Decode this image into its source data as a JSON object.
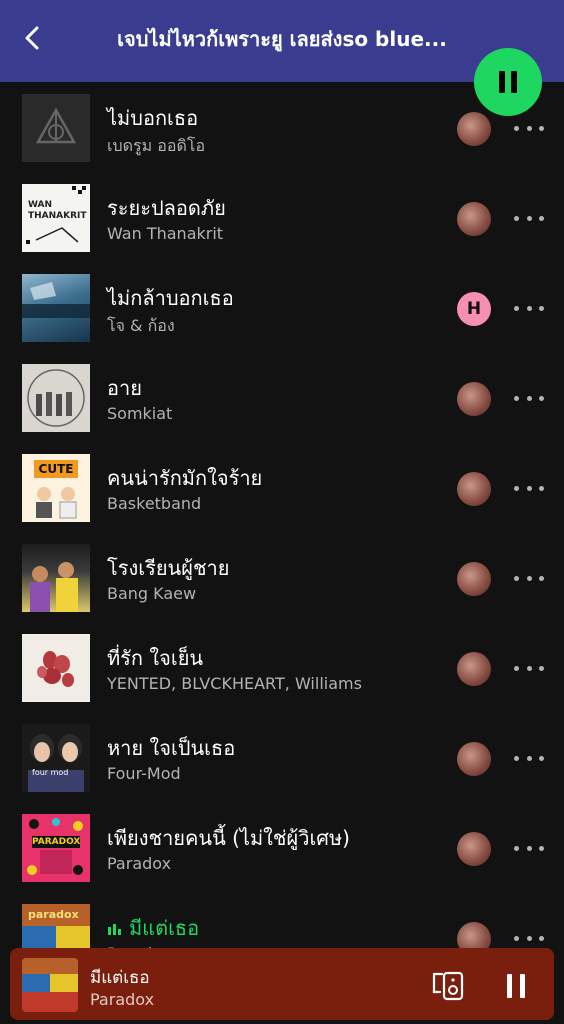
{
  "header": {
    "title": "เจบไม่ไหวก้เพราะยู เลยส่งso blue..."
  },
  "colors": {
    "header_bg": "#3a3d8f",
    "accent": "#1ed760",
    "mini_player_bg": "#7a1f0e"
  },
  "tracks": [
    {
      "title": "ไม่บอกเธอ",
      "artist": "เบดรูม ออดิโอ",
      "avatar": "photo"
    },
    {
      "title": "ระยะปลอดภัย",
      "artist": "Wan Thanakrit",
      "avatar": "photo",
      "cover_text": "WAN THANAKRIT"
    },
    {
      "title": "ไม่กล้าบอกเธอ",
      "artist": "โจ & ก้อง",
      "avatar": "H"
    },
    {
      "title": "อาย",
      "artist": "Somkiat",
      "avatar": "photo"
    },
    {
      "title": "คนน่ารักมักใจร้าย",
      "artist": "Basketband",
      "avatar": "photo",
      "cover_text": "CUTE"
    },
    {
      "title": "โรงเรียนผู้ชาย",
      "artist": "Bang Kaew",
      "avatar": "photo"
    },
    {
      "title": "ที่รัก ใจเย็น",
      "artist": "YENTED, BLVCKHEART, Williams",
      "avatar": "photo"
    },
    {
      "title": "หาย ใจเป็นเธอ",
      "artist": "Four-Mod",
      "avatar": "photo",
      "cover_text": "four mod"
    },
    {
      "title": "เพียงชายคนนี้ (ไม่ใช่ผู้วิเศษ)",
      "artist": "Paradox",
      "avatar": "photo",
      "cover_text": "PARADOX"
    },
    {
      "title": "มีแต่เธอ",
      "artist": "Paradox",
      "avatar": "photo",
      "cover_text": "paradox",
      "playing": true
    }
  ],
  "mini_player": {
    "title": "มีแต่เธอ",
    "artist": "Paradox"
  }
}
